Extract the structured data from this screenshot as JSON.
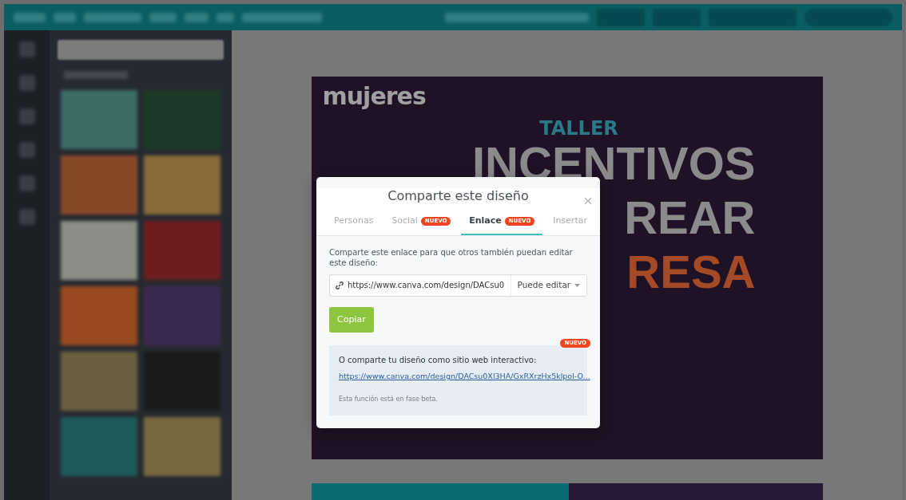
{
  "design": {
    "logo": "mujeres",
    "kicker": "TALLER",
    "headline": [
      {
        "text": "INCENTIVOS",
        "kind": "plain"
      },
      {
        "text": "REAR",
        "kind": "plain"
      },
      {
        "text": "RESA",
        "kind": "accent"
      }
    ]
  },
  "dialog": {
    "title": "Comparte este diseño",
    "tabs": [
      {
        "label": "Personas",
        "selected": false
      },
      {
        "label": "Social",
        "badge": "NUEVO",
        "selected": false
      },
      {
        "label": "Enlace",
        "badge": "NUEVO",
        "selected": true
      },
      {
        "label": "Insertar",
        "selected": false
      }
    ],
    "instructions": "Comparte este enlace para que otros también puedan editar este diseño:",
    "link_field": {
      "value": "https://www.canva.com/design/DACsu0"
    },
    "permission": {
      "value": "Puede editar"
    },
    "copy_button": "Copiar",
    "website": {
      "badge": "NUEVO",
      "text": "O comparte tu diseño como sitio web interactivo:",
      "link": "https://www.canva.com/design/DACsu0Xl3HA/GxRXrzHx5klpol-O...",
      "note": "Esta función está en fase beta."
    }
  }
}
